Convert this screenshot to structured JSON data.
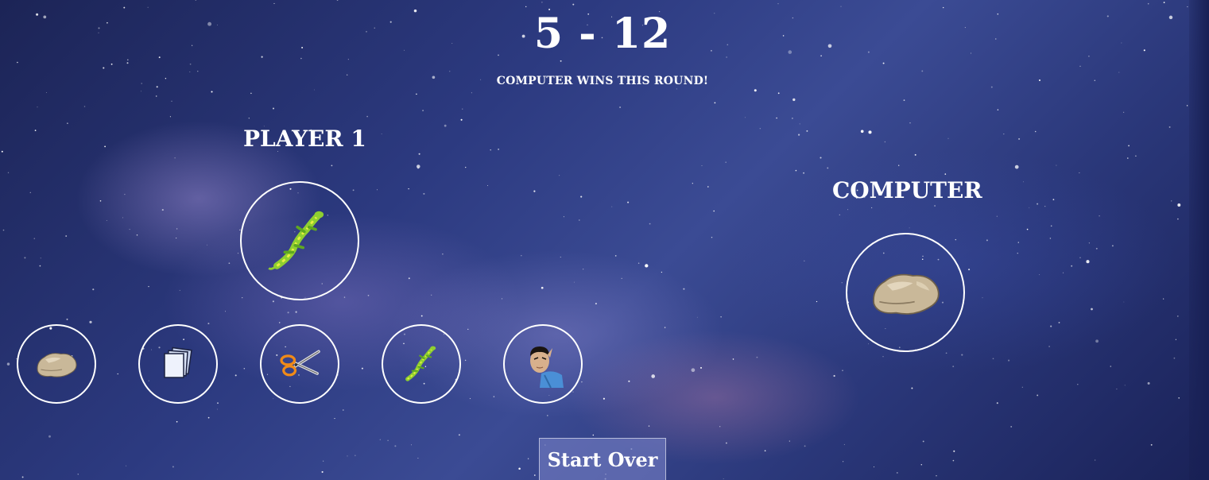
{
  "score": {
    "player": "5",
    "separator": "-",
    "computer": "12"
  },
  "message": "COMPUTER WINS THIS ROUND!",
  "player": {
    "label": "PLAYER 1",
    "selected_icon": "lizard-icon"
  },
  "computer": {
    "label": "COMPUTER",
    "selected_icon": "rock-icon"
  },
  "choices": [
    {
      "name": "rock",
      "icon": "rock-icon"
    },
    {
      "name": "paper",
      "icon": "paper-icon"
    },
    {
      "name": "scissors",
      "icon": "scissors-icon"
    },
    {
      "name": "lizard",
      "icon": "lizard-icon"
    },
    {
      "name": "spock",
      "icon": "spock-icon"
    }
  ],
  "controls": {
    "start_over": "Start Over"
  },
  "colors": {
    "outline": "#ffffff",
    "button_bg": "#6e78be",
    "background": "#2c3a80"
  }
}
